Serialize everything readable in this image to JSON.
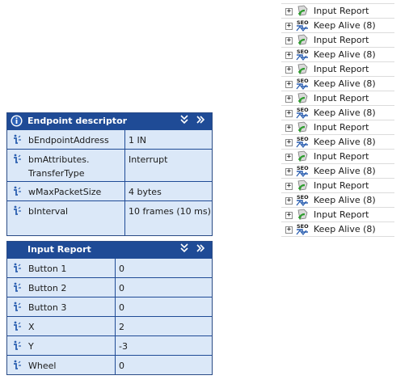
{
  "tree": {
    "items": [
      {
        "label": "Input Report",
        "icon": "input-report-icon"
      },
      {
        "label": "Keep Alive (8)",
        "icon": "seo-keepalive-icon"
      },
      {
        "label": "Input Report",
        "icon": "input-report-icon"
      },
      {
        "label": "Keep Alive (8)",
        "icon": "seo-keepalive-icon"
      },
      {
        "label": "Input Report",
        "icon": "input-report-icon"
      },
      {
        "label": "Keep Alive (8)",
        "icon": "seo-keepalive-icon"
      },
      {
        "label": "Input Report",
        "icon": "input-report-icon"
      },
      {
        "label": "Keep Alive (8)",
        "icon": "seo-keepalive-icon"
      },
      {
        "label": "Input Report",
        "icon": "input-report-icon"
      },
      {
        "label": "Keep Alive (8)",
        "icon": "seo-keepalive-icon"
      },
      {
        "label": "Input Report",
        "icon": "input-report-icon"
      },
      {
        "label": "Keep Alive (8)",
        "icon": "seo-keepalive-icon"
      },
      {
        "label": "Input Report",
        "icon": "input-report-icon"
      },
      {
        "label": "Keep Alive (8)",
        "icon": "seo-keepalive-icon"
      },
      {
        "label": "Input Report",
        "icon": "input-report-icon"
      },
      {
        "label": "Keep Alive (8)",
        "icon": "seo-keepalive-icon"
      }
    ],
    "expander": "+",
    "seo_text": "SEO"
  },
  "endpoint": {
    "title": "Endpoint descriptor",
    "collapse": "¥",
    "expand": "»",
    "rows": [
      {
        "name": "bEndpointAddress",
        "value": "1 IN"
      },
      {
        "name": "bmAttributes. TransferType",
        "value": "Interrupt"
      },
      {
        "name": "wMaxPacketSize",
        "value": "4 bytes"
      },
      {
        "name": "bInterval",
        "value": "10 frames (10 ms)"
      }
    ]
  },
  "report": {
    "title": "Input Report",
    "collapse": "¥",
    "expand": "»",
    "rows": [
      {
        "name": "Button 1",
        "value": "0"
      },
      {
        "name": "Button 2",
        "value": "0"
      },
      {
        "name": "Button 3",
        "value": "0"
      },
      {
        "name": "X",
        "value": "2"
      },
      {
        "name": "Y",
        "value": "-3"
      },
      {
        "name": "Wheel",
        "value": "0"
      }
    ]
  },
  "colors": {
    "header_bg": "#1f4b96",
    "row_bg": "#dbe8f8",
    "border": "#1f4b96"
  }
}
